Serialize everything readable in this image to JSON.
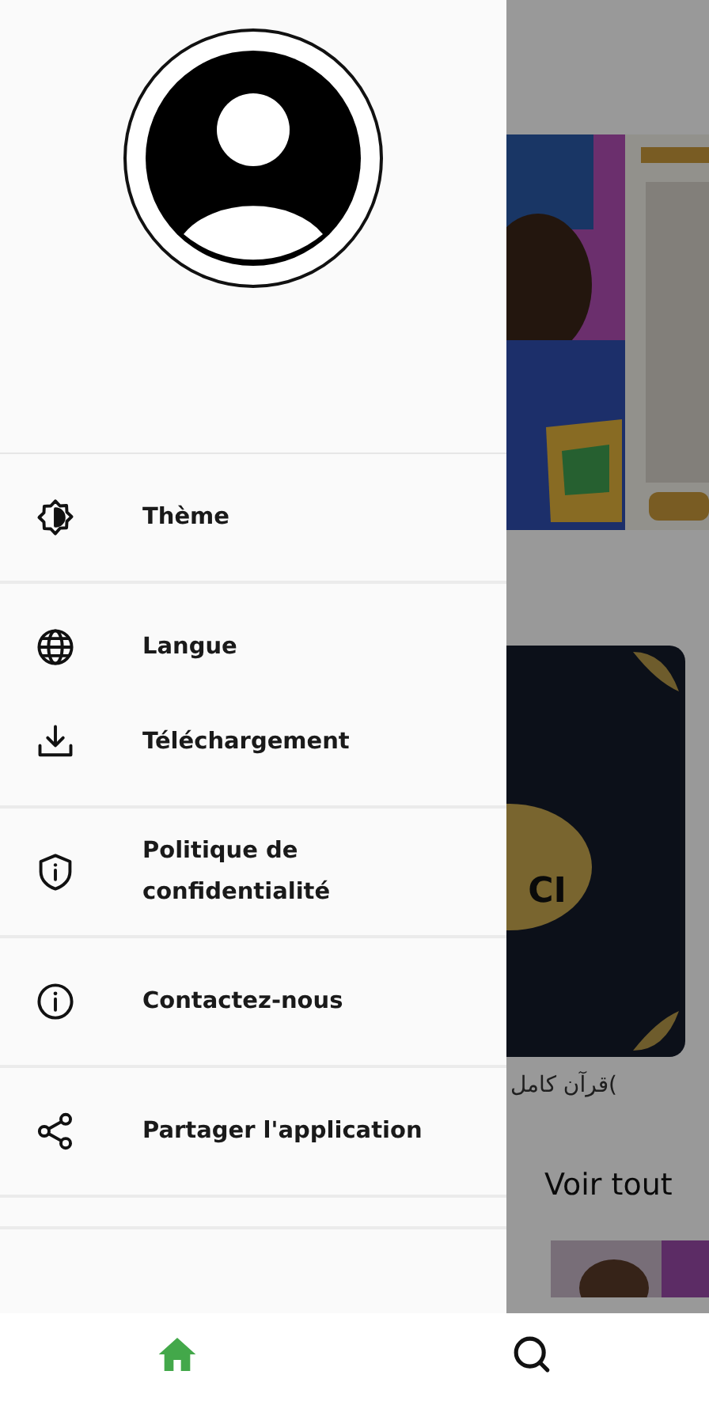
{
  "drawer": {
    "groups": [
      {
        "items": [
          {
            "kind": "theme",
            "label": "Thème"
          }
        ]
      },
      {
        "items": [
          {
            "kind": "globe",
            "label": "Langue"
          },
          {
            "kind": "download",
            "label": "Téléchargement"
          }
        ]
      },
      {
        "items": [
          {
            "kind": "shield",
            "label": "Politique de confidentialité"
          }
        ]
      },
      {
        "items": [
          {
            "kind": "info",
            "label": "Contactez-nous"
          }
        ]
      },
      {
        "items": [
          {
            "kind": "share",
            "label": "Partager l'application"
          }
        ]
      }
    ]
  },
  "background": {
    "card_badge": "CI",
    "card_caption": ")قرآن كامل",
    "see_all": "Voir tout"
  },
  "bottom_nav": [
    {
      "kind": "home",
      "selected": true
    },
    {
      "kind": "search",
      "selected": false
    }
  ]
}
